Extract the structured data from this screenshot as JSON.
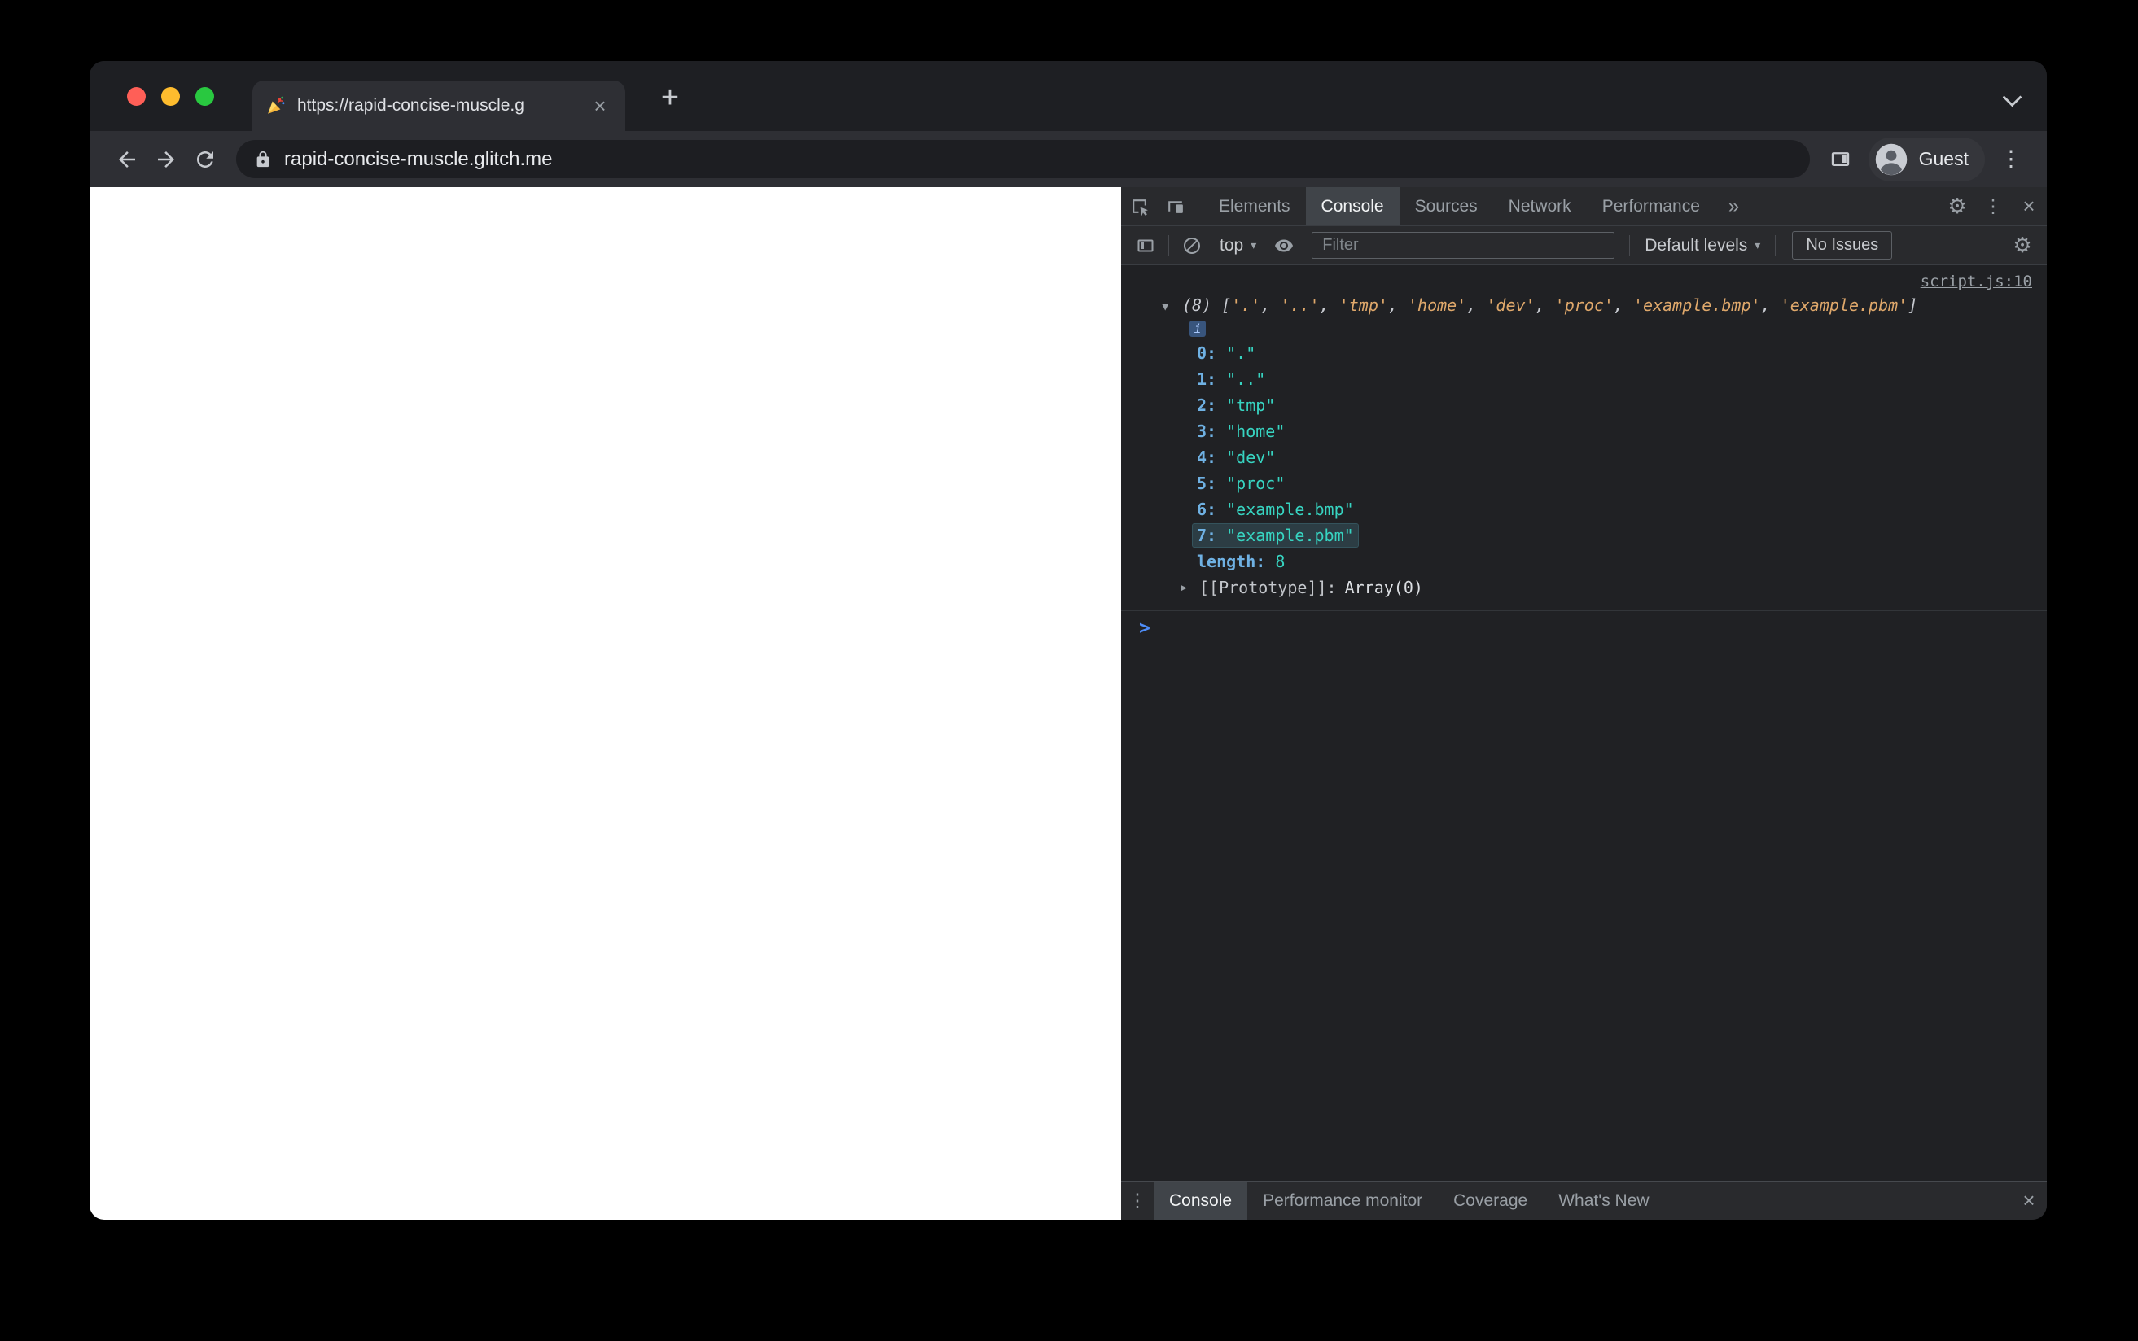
{
  "browser": {
    "tab": {
      "favicon": "party-popper",
      "title": "https://rapid-concise-muscle.g"
    },
    "toolbar": {
      "url": "rapid-concise-muscle.glitch.me",
      "profile_label": "Guest"
    }
  },
  "devtools": {
    "main_tabs": [
      "Elements",
      "Console",
      "Sources",
      "Network",
      "Performance"
    ],
    "active_main_tab": "Console",
    "console_toolbar": {
      "context_selector": "top",
      "filter_placeholder": "Filter",
      "levels_label": "Default levels",
      "issues_label": "No Issues"
    },
    "console": {
      "source_link": "script.js:10",
      "preview_parts": [
        {
          "text": "(8) ",
          "type": "meta"
        },
        {
          "text": "[",
          "type": "punct"
        },
        {
          "text": "'.'",
          "type": "string"
        },
        {
          "text": ", ",
          "type": "punct"
        },
        {
          "text": "'..'",
          "type": "string"
        },
        {
          "text": ", ",
          "type": "punct"
        },
        {
          "text": "'tmp'",
          "type": "string"
        },
        {
          "text": ", ",
          "type": "punct"
        },
        {
          "text": "'home'",
          "type": "string"
        },
        {
          "text": ", ",
          "type": "punct"
        },
        {
          "text": "'dev'",
          "type": "string"
        },
        {
          "text": ", ",
          "type": "punct"
        },
        {
          "text": "'proc'",
          "type": "string"
        },
        {
          "text": ", ",
          "type": "punct"
        },
        {
          "text": "'example.bmp'",
          "type": "string"
        },
        {
          "text": ", ",
          "type": "punct"
        },
        {
          "text": "'example.pbm'",
          "type": "string"
        },
        {
          "text": "]",
          "type": "punct"
        }
      ],
      "entries": [
        {
          "index": "0",
          "value": "\".\""
        },
        {
          "index": "1",
          "value": "\"..\""
        },
        {
          "index": "2",
          "value": "\"tmp\""
        },
        {
          "index": "3",
          "value": "\"home\""
        },
        {
          "index": "4",
          "value": "\"dev\""
        },
        {
          "index": "5",
          "value": "\"proc\""
        },
        {
          "index": "6",
          "value": "\"example.bmp\""
        },
        {
          "index": "7",
          "value": "\"example.pbm\"",
          "highlighted": true
        }
      ],
      "length_label": "length:",
      "length_value": "8",
      "prototype_label": "[[Prototype]]:",
      "prototype_value": "Array(0)"
    },
    "drawer": {
      "tabs": [
        "Console",
        "Performance monitor",
        "Coverage",
        "What's New"
      ],
      "active_tab": "Console"
    }
  },
  "icons": {
    "new_tab": "+",
    "close": "×",
    "kebab_vertical": "⋮",
    "more_tabs": "»",
    "gear": "⚙",
    "caret_down": "▾",
    "expand_open": "▼",
    "expand_closed": "▶",
    "info": "i",
    "prompt": ">"
  },
  "colors": {
    "traffic_close": "#ff5f57",
    "traffic_minimize": "#febc2e",
    "traffic_maximize": "#29c840",
    "devtools_background": "#202124",
    "devtools_bar": "#292a2d",
    "prompt_blue": "#4e8df7",
    "index_blue": "#6fb1e3",
    "string_teal": "#37d4c1",
    "preview_string_orange": "#dfa86b",
    "muted_text": "#9aa0a6"
  }
}
